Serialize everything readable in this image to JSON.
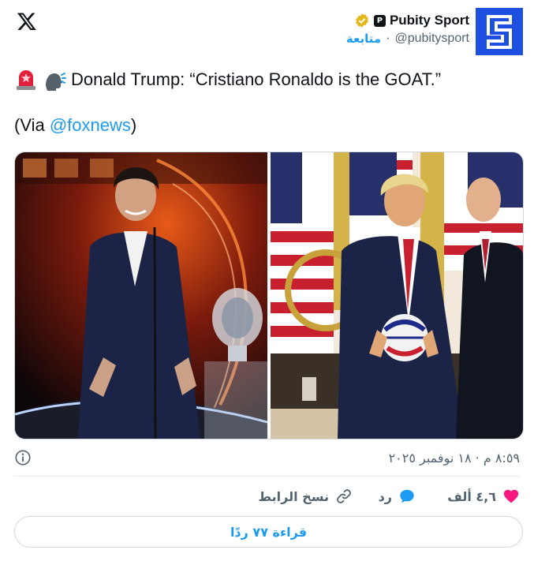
{
  "account": {
    "display_name": "Pubity Sport",
    "handle": "@pubitysport",
    "follow_label": "متابعة",
    "badge_letter": "P",
    "verified": true
  },
  "tweet": {
    "line1": "Donald Trump: “Cristiano Ronaldo is the GOAT.”",
    "line2_prefix": "(Via ",
    "line2_mention": "@foxnews",
    "line2_suffix": ")"
  },
  "media": {
    "images": [
      "cristiano-ronaldo-on-stage-photo",
      "donald-trump-holding-football-photo"
    ]
  },
  "meta": {
    "timestamp": "٨:٥٩ م · ١٨ نوفمبر ٢٠٢٥"
  },
  "actions": {
    "likes": "٤,٦ ألف",
    "reply_label": "رد",
    "copy_link_label": "نسخ الرابط"
  },
  "replies_button": "قراءة ٧٧ ردًا",
  "colors": {
    "accent": "#1d9bf0",
    "like": "#f91880",
    "text": "#0f1419",
    "muted": "#536471",
    "avatar": "#1d4fe0"
  },
  "icons": [
    "x-logo-icon",
    "verified-icon",
    "info-icon",
    "heart-icon",
    "reply-icon",
    "link-icon",
    "siren-emoji-icon",
    "speaking-head-emoji-icon"
  ]
}
